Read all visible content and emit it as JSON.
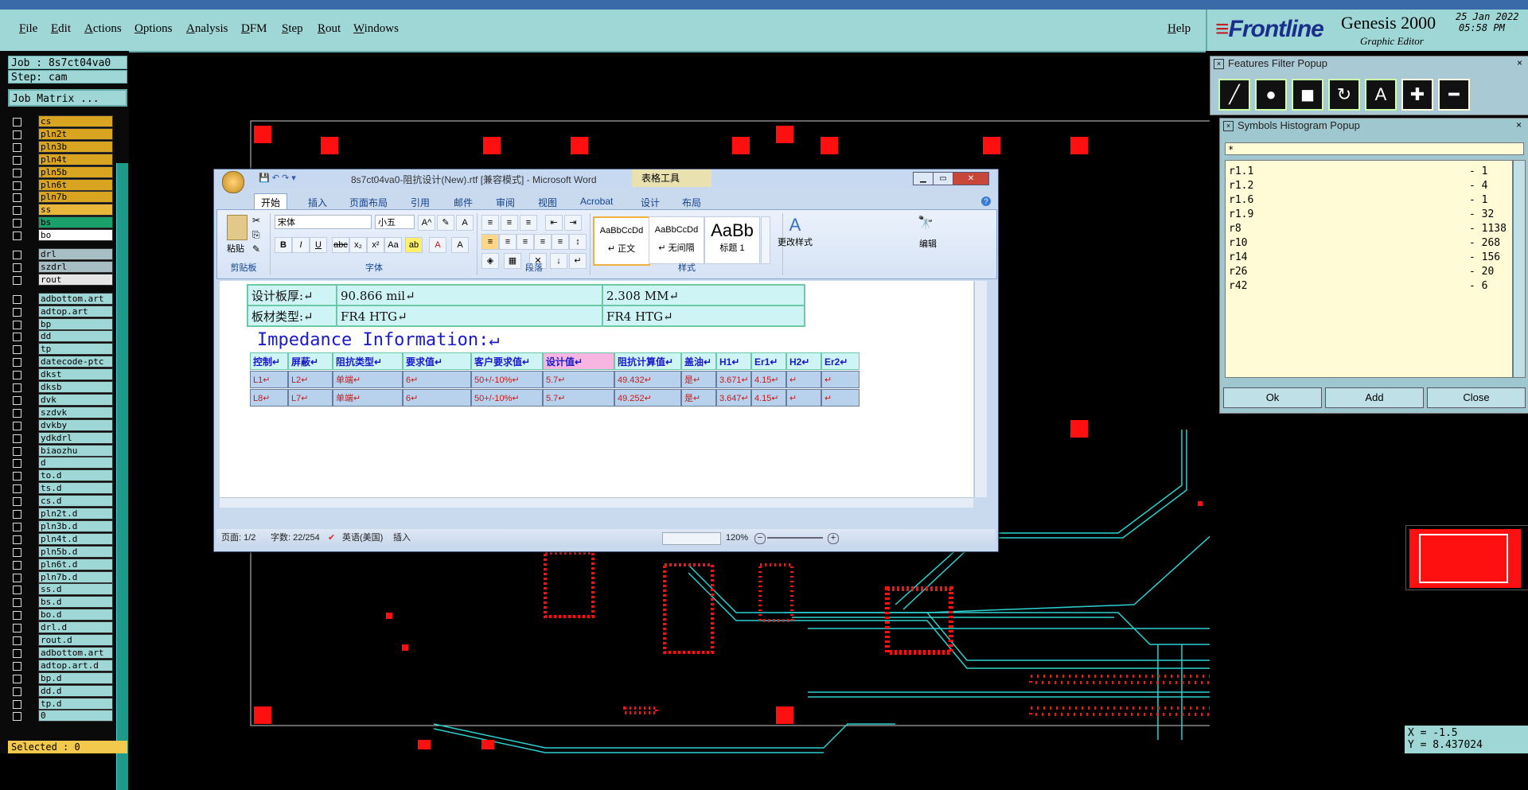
{
  "menu": [
    "File",
    "Edit",
    "Actions",
    "Options",
    "Analysis",
    "DFM",
    "Step",
    "Rout",
    "Windows"
  ],
  "help": "Help",
  "brand": {
    "logo": "Frontline",
    "product": "Genesis 2000",
    "subtitle": "Graphic Editor",
    "date": "25 Jan 2022",
    "time": "05:58 PM"
  },
  "job": {
    "job_label": "Job : 8s7ct04va0",
    "step_label": "Step: cam",
    "matrix_button": "Job Matrix ..."
  },
  "layers": [
    {
      "name": "cs",
      "color": "#d9a520"
    },
    {
      "name": "pln2t",
      "color": "#d9a520"
    },
    {
      "name": "pln3b",
      "color": "#d9a520"
    },
    {
      "name": "pln4t",
      "color": "#d9a520"
    },
    {
      "name": "pln5b",
      "color": "#d9a520"
    },
    {
      "name": "pln6t",
      "color": "#d9a520"
    },
    {
      "name": "pln7b",
      "color": "#d9a520"
    },
    {
      "name": "ss",
      "color": "#e8b73a"
    },
    {
      "name": "bs",
      "color": "#1aa06a"
    },
    {
      "name": "bo",
      "color": "#ffffff"
    },
    {
      "name": "drl",
      "color": "#a7bfc4"
    },
    {
      "name": "szdrl",
      "color": "#a7bfc4"
    },
    {
      "name": "rout",
      "color": "#e5e5e5"
    },
    {
      "name": "adbottom.art",
      "color": "#9fd6d6"
    },
    {
      "name": "adtop.art",
      "color": "#9fd6d6"
    },
    {
      "name": "bp",
      "color": "#9fd6d6"
    },
    {
      "name": "dd",
      "color": "#9fd6d6"
    },
    {
      "name": "tp",
      "color": "#9fd6d6"
    },
    {
      "name": "datecode-ptc",
      "color": "#9fd6d6"
    },
    {
      "name": "dkst",
      "color": "#9fd6d6"
    },
    {
      "name": "dksb",
      "color": "#9fd6d6"
    },
    {
      "name": "dvk",
      "color": "#9fd6d6"
    },
    {
      "name": "szdvk",
      "color": "#9fd6d6"
    },
    {
      "name": "dvkby",
      "color": "#9fd6d6"
    },
    {
      "name": "ydkdrl",
      "color": "#9fd6d6"
    },
    {
      "name": "biaozhu",
      "color": "#9fd6d6"
    },
    {
      "name": "d",
      "color": "#9fd6d6"
    },
    {
      "name": "to.d",
      "color": "#9fd6d6"
    },
    {
      "name": "ts.d",
      "color": "#9fd6d6"
    },
    {
      "name": "cs.d",
      "color": "#9fd6d6"
    },
    {
      "name": "pln2t.d",
      "color": "#9fd6d6"
    },
    {
      "name": "pln3b.d",
      "color": "#9fd6d6"
    },
    {
      "name": "pln4t.d",
      "color": "#9fd6d6"
    },
    {
      "name": "pln5b.d",
      "color": "#9fd6d6"
    },
    {
      "name": "pln6t.d",
      "color": "#9fd6d6"
    },
    {
      "name": "pln7b.d",
      "color": "#9fd6d6"
    },
    {
      "name": "ss.d",
      "color": "#9fd6d6"
    },
    {
      "name": "bs.d",
      "color": "#9fd6d6"
    },
    {
      "name": "bo.d",
      "color": "#9fd6d6"
    },
    {
      "name": "drl.d",
      "color": "#9fd6d6"
    },
    {
      "name": "rout.d",
      "color": "#9fd6d6"
    },
    {
      "name": "adbottom.art",
      "color": "#9fd6d6"
    },
    {
      "name": "adtop.art.d",
      "color": "#9fd6d6"
    },
    {
      "name": "bp.d",
      "color": "#9fd6d6"
    },
    {
      "name": "dd.d",
      "color": "#9fd6d6"
    },
    {
      "name": "tp.d",
      "color": "#9fd6d6"
    },
    {
      "name": "0",
      "color": "#9fd6d6"
    }
  ],
  "selected": "Selected : 0",
  "features_filter": {
    "title": "Features Filter Popup"
  },
  "symbols_histogram": {
    "title": "Symbols Histogram Popup",
    "filter": "*",
    "rows": [
      {
        "symbol": "r1.1",
        "count": "- 1"
      },
      {
        "symbol": "r1.2",
        "count": "- 4"
      },
      {
        "symbol": "r1.6",
        "count": "- 1"
      },
      {
        "symbol": "r1.9",
        "count": "- 32"
      },
      {
        "symbol": "r8",
        "count": "- 1138"
      },
      {
        "symbol": "r10",
        "count": "- 268"
      },
      {
        "symbol": "r14",
        "count": "- 156"
      },
      {
        "symbol": "r26",
        "count": "- 20"
      },
      {
        "symbol": "r42",
        "count": "- 6"
      }
    ],
    "ok": "Ok",
    "add": "Add",
    "close": "Close"
  },
  "coords": {
    "x": "X = -1.5",
    "y": "Y = 8.437024"
  },
  "word": {
    "title": "8s7ct04va0-阻抗设计(New).rtf [兼容模式] - Microsoft Word",
    "context_tab": "表格工具",
    "tabs": [
      "开始",
      "插入",
      "页面布局",
      "引用",
      "邮件",
      "审阅",
      "视图",
      "Acrobat",
      "设计",
      "布局"
    ],
    "clipboard": {
      "paste": "粘贴",
      "label": "剪贴板"
    },
    "font": {
      "name": "宋体",
      "size": "小五",
      "label": "字体"
    },
    "paragraph_label": "段落",
    "styles": [
      {
        "preview": "AaBbCcDd",
        "name": "↵ 正文"
      },
      {
        "preview": "AaBbCcDd",
        "name": "↵ 无间隔"
      },
      {
        "preview": "AaBb",
        "name": "标题 1"
      }
    ],
    "change_styles": "更改样式",
    "styles_label": "样式",
    "edit": "编辑",
    "doc": {
      "row1": {
        "label": "设计板厚:↵",
        "v1": "90.866 mil↵",
        "v2": "2.308 MM↵"
      },
      "row2": {
        "label": "板材类型:↵",
        "v1": "FR4 HTG↵",
        "v2": "FR4 HTG↵"
      },
      "heading": "Impedance Information:↵",
      "headers": [
        "控制↵",
        "屏蔽↵",
        "阻抗类型↵",
        "要求值↵",
        "客户要求值↵",
        "设计值↵",
        "阻抗计算值↵",
        "盖油↵",
        "H1↵",
        "Er1↵",
        "H2↵",
        "Er2↵"
      ],
      "rows": [
        [
          "L1↵",
          "L2↵",
          "单端↵",
          "6↵",
          "50+/-10%↵",
          "5.7↵",
          "49.432↵",
          "是↵",
          "3.671↵",
          "4.15↵",
          "↵",
          "↵"
        ],
        [
          "L8↵",
          "L7↵",
          "单端↵",
          "6↵",
          "50+/-10%↵",
          "5.7↵",
          "49.252↵",
          "是↵",
          "3.647↵",
          "4.15↵",
          "↵",
          "↵"
        ]
      ]
    },
    "status": {
      "page": "页面: 1/2",
      "words": "字数: 22/254",
      "lang": "英语(美国)",
      "mode": "插入",
      "zoom": "120%"
    }
  }
}
